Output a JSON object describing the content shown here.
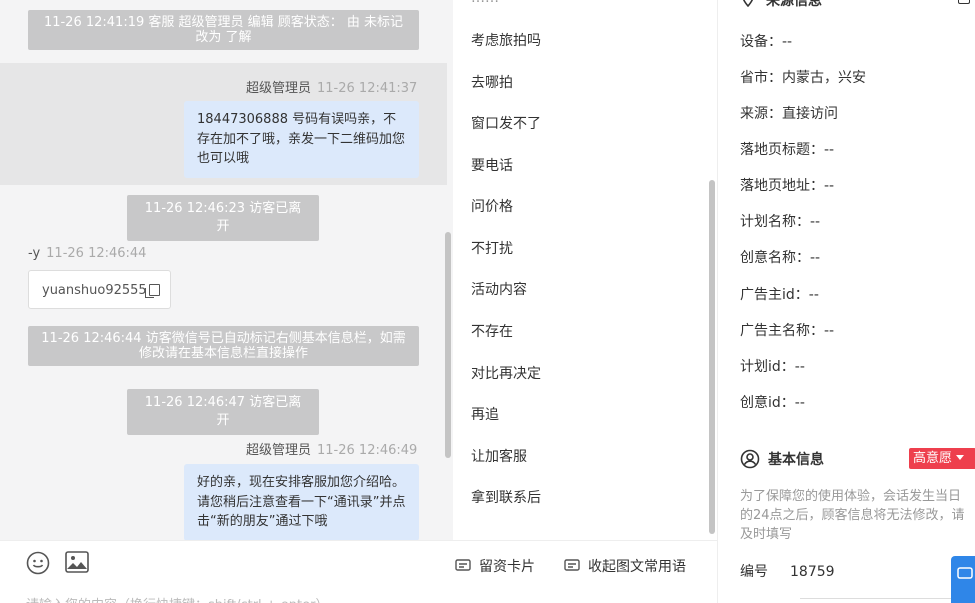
{
  "chat": {
    "system_top": "11-26 12:41:19 客服 超级管理员 编辑 顾客状态： 由 未标记 改为 了解",
    "msg1": {
      "sender": "超级管理员",
      "time": "11-26 12:41:37",
      "text": "18447306888 号码有误吗亲，不存在加不了哦，亲发一下二维码加您也可以哦"
    },
    "system_leave1": "11-26 12:46:23 访客已离开",
    "visitor": {
      "sender": "-y",
      "time": "11-26 12:46:44",
      "card_text": "yuanshuo92555"
    },
    "system_wechat": "11-26 12:46:44 访客微信号已自动标记右侧基本信息栏，如需修改请在基本信息栏直接操作",
    "system_leave2": "11-26 12:46:47 访客已离开",
    "msg2": {
      "sender": "超级管理员",
      "time": "11-26 12:46:49",
      "text": "好的亲，现在安排客服加您介绍哈。请您稍后注意查看一下“通讯录”并点击“新的朋友”通过下哦"
    }
  },
  "phrases": [
    "考虑旅拍吗",
    "去哪拍",
    "窗口发不了",
    "要电话",
    "问价格",
    "不打扰",
    "活动内容",
    "不存在",
    "对比再决定",
    "再追",
    "让加客服",
    "拿到联系后"
  ],
  "source_info": {
    "title": "来源信息",
    "fields": [
      "设备：--",
      "省市：内蒙古，兴安",
      "来源：直接访问",
      "落地页标题：--",
      "落地页地址：--",
      "计划名称：--",
      "创意名称：--",
      "广告主id：--",
      "广告主名称：--",
      "计划id：--",
      "创意id：--"
    ]
  },
  "basic_info": {
    "title": "基本信息",
    "badge": "高意愿",
    "notice": "为了保障您的使用体验，会话发生当日的24点之后，顾客信息将无法修改，请及时填写",
    "id_label": "编号",
    "id_value": "18759"
  },
  "input": {
    "card_button": "留资卡片",
    "collect_button": "收起图文常用语",
    "placeholder": "请输入您的内容（换行快捷键：shift/ctrl + enter）"
  },
  "colors": {
    "bubble": "#dce9fb",
    "badge": "#ee3f4d",
    "accent": "#2f86e8"
  }
}
